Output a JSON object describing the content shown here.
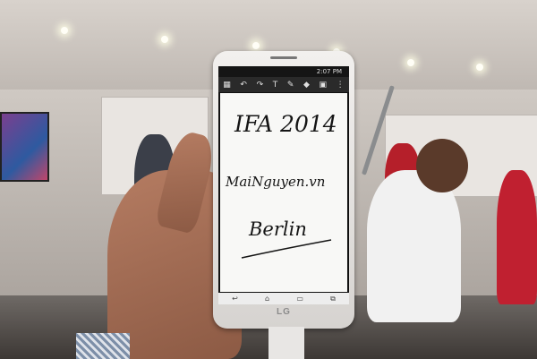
{
  "photo": {
    "phone": {
      "status_bar": {
        "time": "2:07 PM"
      },
      "toolbar_icons": [
        "grid-icon",
        "undo-icon",
        "redo-icon",
        "text-icon",
        "pen-icon",
        "eraser-icon",
        "save-icon",
        "menu-icon"
      ],
      "handwriting": {
        "line1": "IFA 2014",
        "line2": "MaiNguyen.vn",
        "line3": "Berlin"
      },
      "nav_icons": [
        "back-icon",
        "home-icon",
        "recents-icon",
        "dual-window-icon"
      ],
      "brand": "LG"
    },
    "colors": {
      "phone_body": "#f2f0ee",
      "screen_canvas": "#f8f8f6",
      "ink": "#151515"
    }
  }
}
